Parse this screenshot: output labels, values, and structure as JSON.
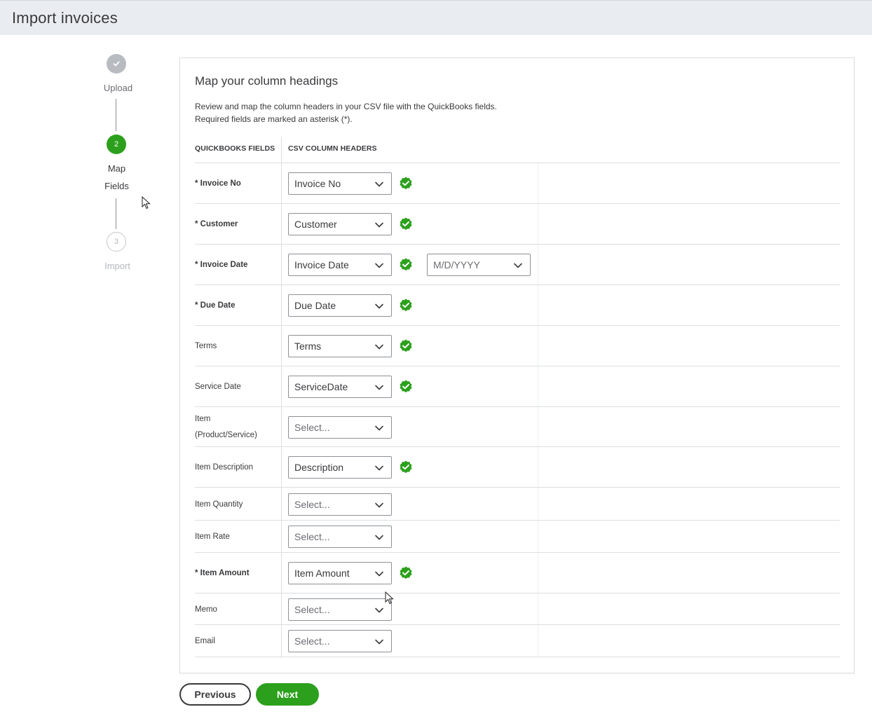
{
  "header": {
    "title": "Import invoices"
  },
  "stepper": {
    "steps": [
      {
        "label": "Upload",
        "number": "",
        "state": "done"
      },
      {
        "label": "Map\nFields",
        "label_line1": "Map",
        "label_line2": "Fields",
        "number": "2",
        "state": "active"
      },
      {
        "label": "Import",
        "number": "3",
        "state": "todo"
      }
    ]
  },
  "card": {
    "title": "Map your column headings",
    "desc_line1": "Review and map the column headers in your CSV file with the QuickBooks fields.",
    "desc_line2": "Required fields are marked an asterisk (*).",
    "col_quickbooks": "QUICKBOOKS FIELDS",
    "col_csv": "CSV COLUMN HEADERS"
  },
  "rows": [
    {
      "label": "* Invoice No",
      "value": "Invoice No",
      "placeholder": false,
      "mapped": true
    },
    {
      "label": "* Customer",
      "value": "Customer",
      "placeholder": false,
      "mapped": true
    },
    {
      "label": "* Invoice Date",
      "value": "Invoice Date",
      "placeholder": false,
      "mapped": true,
      "date_format": "M/D/YYYY"
    },
    {
      "label": "* Due Date",
      "value": "Due Date",
      "placeholder": false,
      "mapped": true
    },
    {
      "label": "Terms",
      "value": "Terms",
      "placeholder": false,
      "mapped": true
    },
    {
      "label": "Service Date",
      "value": "ServiceDate",
      "placeholder": false,
      "mapped": true
    },
    {
      "label": "Item (Product/Service)",
      "label_line1": "Item",
      "label_line2": "(Product/Service)",
      "value": "Select...",
      "placeholder": true,
      "mapped": false
    },
    {
      "label": "Item Description",
      "value": "Description",
      "placeholder": false,
      "mapped": true
    },
    {
      "label": "Item Quantity",
      "value": "Select...",
      "placeholder": true,
      "mapped": false
    },
    {
      "label": "Item Rate",
      "value": "Select...",
      "placeholder": true,
      "mapped": false
    },
    {
      "label": "* Item Amount",
      "value": "Item Amount",
      "placeholder": false,
      "mapped": true
    },
    {
      "label": "Memo",
      "value": "Select...",
      "placeholder": true,
      "mapped": false
    },
    {
      "label": "Email",
      "value": "Select...",
      "placeholder": true,
      "mapped": false
    }
  ],
  "buttons": {
    "previous": "Previous",
    "next": "Next"
  },
  "colors": {
    "brand_green": "#2ca01c",
    "text": "#393a3d",
    "header_bg": "#e9ecf0"
  },
  "icons": {
    "done_step": "check-icon",
    "mapped": "check-circle-icon",
    "dropdown": "chevron-down-icon",
    "pointer": "mouse-cursor-icon"
  }
}
